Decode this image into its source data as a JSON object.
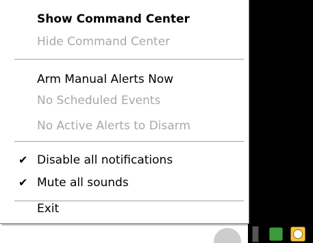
{
  "menu": {
    "items": [
      {
        "label": "Show Command Center",
        "state": "default"
      },
      {
        "label": "Hide Command Center",
        "state": "disabled"
      },
      {
        "label": "Arm Manual Alerts Now",
        "state": "enabled"
      },
      {
        "label": "No Scheduled Events",
        "state": "disabled"
      },
      {
        "label": "No Active Alerts to Disarm",
        "state": "disabled"
      },
      {
        "label": "Disable all notifications",
        "state": "checked"
      },
      {
        "label": "Mute all sounds",
        "state": "checked"
      },
      {
        "label": "Exit",
        "state": "enabled"
      }
    ],
    "check_glyph": "✔"
  },
  "tray": {
    "icons": [
      "network-icon",
      "device-icon",
      "security-shield-icon",
      "alarm-clock-icon"
    ]
  }
}
